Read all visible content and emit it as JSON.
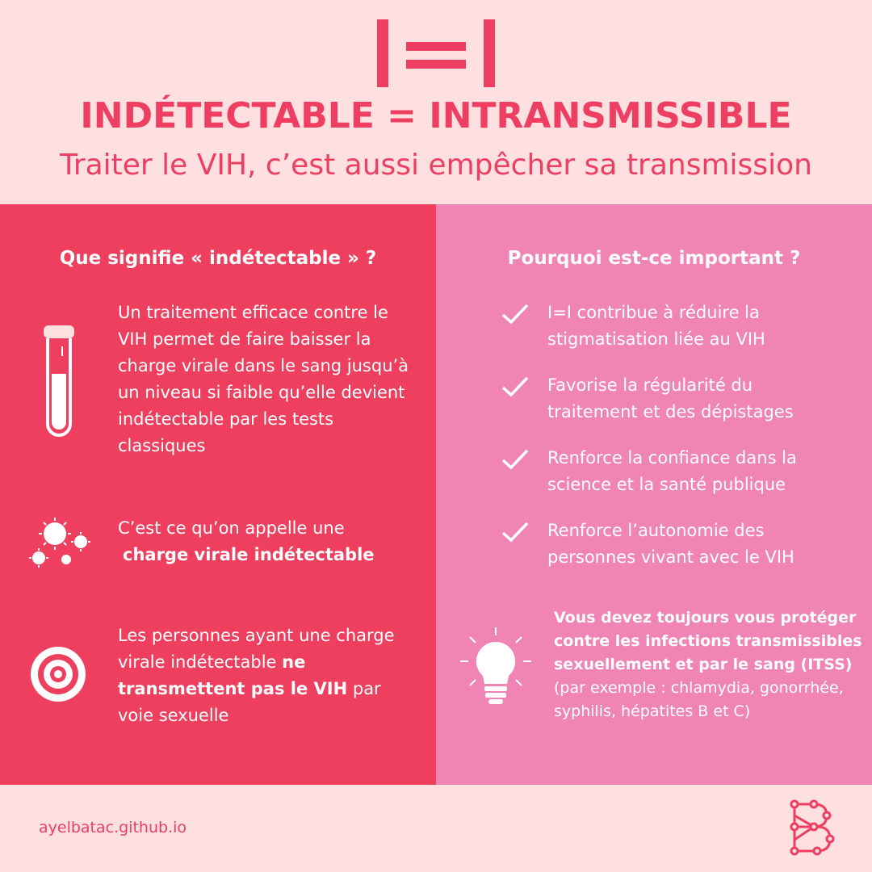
{
  "header": {
    "logo_mark": "I=I",
    "headline": "INDÉTECTABLE = INTRANSMISSIBLE",
    "subtitle": "Traiter le VIH, c’est aussi empêcher sa transmission"
  },
  "left": {
    "title": "Que signifie « indétectable » ?",
    "block1": "Un traitement efficace contre le VIH permet de faire baisser la charge virale dans le sang jusqu’à un niveau si faible qu’elle devient indétectable par les tests classiques",
    "block2_pre": "C’est ce qu’on appelle une",
    "block2_bold": "charge virale indétectable",
    "block3_pre": "Les personnes ayant une charge virale indétectable",
    "block3_bold": "ne transmettent pas le VIH",
    "block3_post": "par voie sexuelle"
  },
  "right": {
    "title": "Pourquoi est-ce important ?",
    "items": [
      "I=I contribue à réduire la stigmatisation liée au VIH",
      "Favorise la régularité du traitement et des dépistages",
      "Renforce la confiance dans la science et la santé publique",
      "Renforce l’autonomie des personnes vivant avec le VIH"
    ],
    "note_bold": "Vous devez toujours vous protéger contre les infections transmissibles sexuellement et par le sang (ITSS)",
    "note_text": "(par exemple : chlamydia, gonorrhée, syphilis, hépatites B et C)"
  },
  "footer": {
    "url": "ayelbatac.github.io"
  },
  "colors": {
    "accent": "#ee3f62",
    "background": "#fde0df",
    "panel_left": "#ef3f5f",
    "panel_right": "#f084b5",
    "text_light": "#ffffff"
  },
  "icons": [
    "test-tube-icon",
    "virus-icon",
    "target-icon",
    "check-icon",
    "lightbulb-icon",
    "brand-logo-icon"
  ]
}
